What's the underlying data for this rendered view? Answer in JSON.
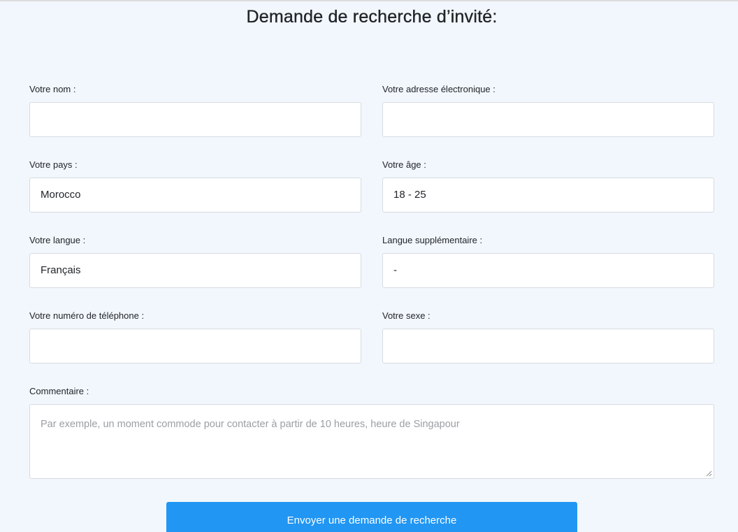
{
  "form": {
    "title": "Demande de recherche d’invité:",
    "name": {
      "label": "Votre nom :",
      "value": ""
    },
    "email": {
      "label": "Votre adresse électronique :",
      "value": ""
    },
    "country": {
      "label": "Votre pays :",
      "value": "Morocco"
    },
    "age": {
      "label": "Votre âge :",
      "value": "18 - 25"
    },
    "language": {
      "label": "Votre langue :",
      "value": "Français"
    },
    "extra_language": {
      "label": "Langue supplémentaire :",
      "value": "-"
    },
    "phone": {
      "label": "Votre numéro de téléphone :",
      "value": ""
    },
    "gender": {
      "label": "Votre sexe :",
      "value": ""
    },
    "comment": {
      "label": "Commentaire :",
      "value": "",
      "placeholder": "Par exemple, un moment commode pour contacter à partir de 10 heures, heure de Singapour"
    },
    "submit_label": "Envoyer une demande de recherche"
  },
  "colors": {
    "background": "#f2f7fd",
    "button": "#2196f3",
    "input_border": "#d6dbe0",
    "placeholder": "#9a9fa4"
  }
}
